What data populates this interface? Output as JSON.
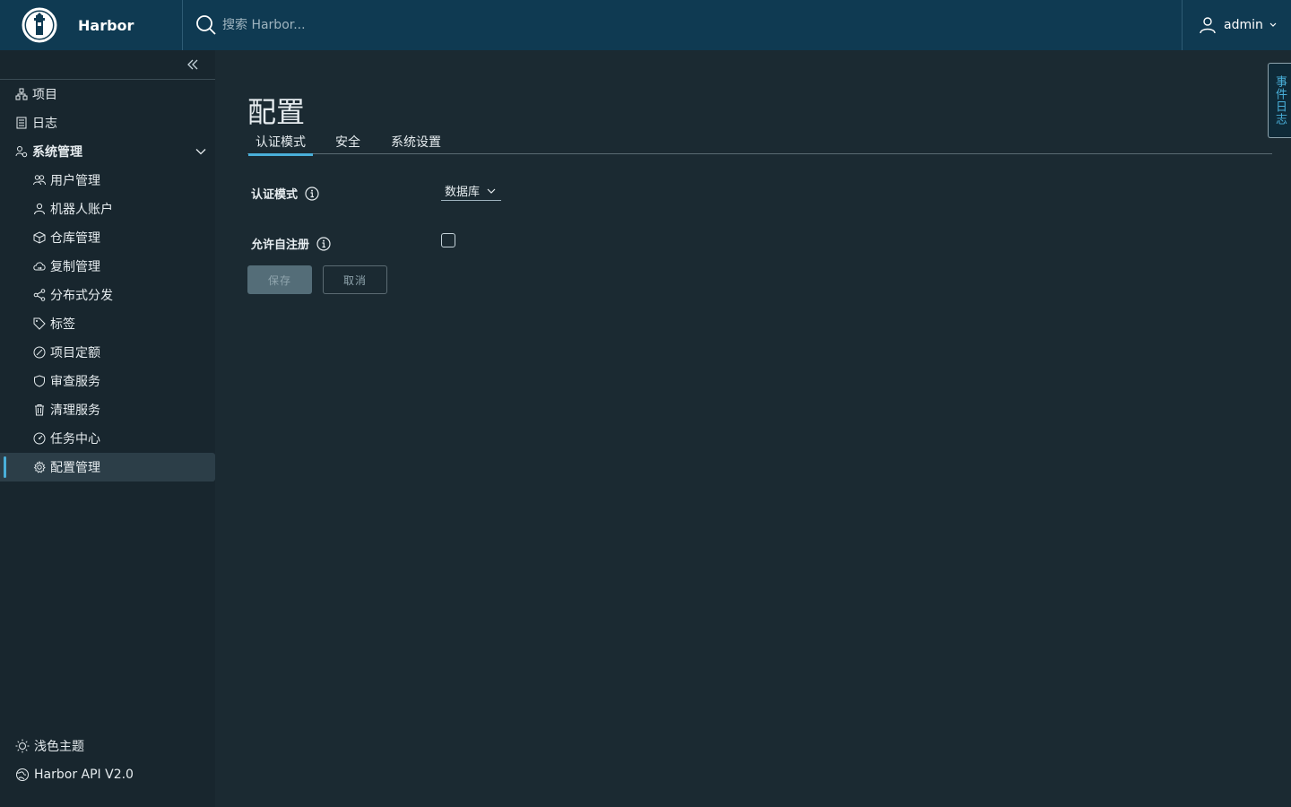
{
  "header": {
    "brand": "Harbor",
    "search_placeholder": "搜索 Harbor...",
    "user": "admin"
  },
  "sidebar": {
    "items": [
      {
        "label": "项目",
        "icon": "project-icon"
      },
      {
        "label": "日志",
        "icon": "log-icon"
      },
      {
        "label": "系统管理",
        "icon": "admin-icon",
        "expanded": true
      }
    ],
    "sub_items": [
      {
        "label": "用户管理",
        "icon": "users-icon"
      },
      {
        "label": "机器人账户",
        "icon": "robot-icon"
      },
      {
        "label": "仓库管理",
        "icon": "registry-icon"
      },
      {
        "label": "复制管理",
        "icon": "replication-icon"
      },
      {
        "label": "分布式分发",
        "icon": "share-icon"
      },
      {
        "label": "标签",
        "icon": "tag-icon"
      },
      {
        "label": "项目定额",
        "icon": "quota-icon"
      },
      {
        "label": "审查服务",
        "icon": "shield-icon"
      },
      {
        "label": "清理服务",
        "icon": "trash-icon"
      },
      {
        "label": "任务中心",
        "icon": "dashboard-icon"
      },
      {
        "label": "配置管理",
        "icon": "gear-icon",
        "active": true
      }
    ],
    "bottom": [
      {
        "label": "浅色主题",
        "icon": "sun-icon"
      },
      {
        "label": "Harbor API V2.0",
        "icon": "api-icon"
      }
    ]
  },
  "main": {
    "title": "配置",
    "tabs": [
      {
        "label": "认证模式",
        "active": true
      },
      {
        "label": "安全"
      },
      {
        "label": "系统设置"
      }
    ],
    "auth_mode_label": "认证模式",
    "auth_mode_value": "数据库",
    "self_reg_label": "允许自注册",
    "self_reg_checked": false,
    "save_label": "保存",
    "cancel_label": "取消"
  },
  "event_log_label": "事件日志",
  "colors": {
    "header_bg": "#0f3a52",
    "sidebar_bg": "#18262e",
    "main_bg": "#1b2a32",
    "accent": "#49afd9"
  }
}
